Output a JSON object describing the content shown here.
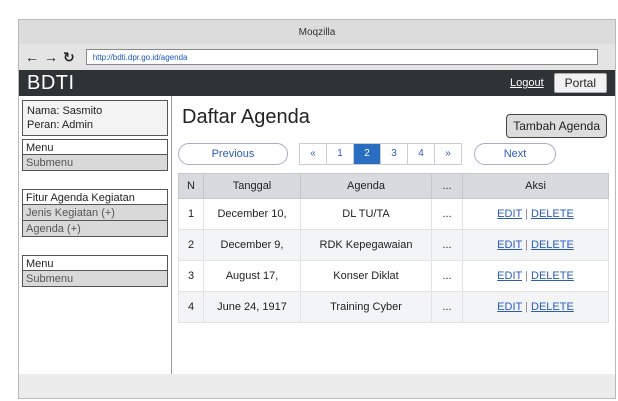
{
  "browser": {
    "title": "Moqzilla",
    "url": "http://bdti.dpr.go.id/agenda",
    "nav": [
      "←",
      "→",
      "↻"
    ]
  },
  "app": {
    "brand": "BDTI",
    "logout": "Logout",
    "portal": "Portal"
  },
  "user": {
    "nama": "Nama: Sasmito",
    "peran": "Peran: Admin"
  },
  "sidebar": {
    "menu1": "Menu",
    "submenu1": "Submenu",
    "fitur": "Fitur Agenda Kegiatan",
    "jenis": "Jenis Kegiatan (+)",
    "agenda": "Agenda (+)",
    "menu2": "Menu",
    "submenu2": "Submenu"
  },
  "main": {
    "title": "Daftar Agenda",
    "add_button": "Tambah Agenda"
  },
  "pager": {
    "previous": "Previous",
    "next": "Next",
    "first": "«",
    "last": "»",
    "pages": [
      "1",
      "2",
      "3",
      "4"
    ],
    "active": "2"
  },
  "table": {
    "headers": [
      "N",
      "Tanggal",
      "Agenda",
      "...",
      "Aksi"
    ],
    "rows": [
      {
        "n": "1",
        "tanggal": "December 10,",
        "agenda": "DL TU/TA",
        "more": "...",
        "edit": "EDIT",
        "delete": "DELETE"
      },
      {
        "n": "2",
        "tanggal": "December 9,",
        "agenda": "RDK Kepegawaian",
        "more": "...",
        "edit": "EDIT",
        "delete": "DELETE"
      },
      {
        "n": "3",
        "tanggal": "August 17,",
        "agenda": "Konser Diklat",
        "more": "...",
        "edit": "EDIT",
        "delete": "DELETE"
      },
      {
        "n": "4",
        "tanggal": "June 24, 1917",
        "agenda": "Training Cyber",
        "more": "...",
        "edit": "EDIT",
        "delete": "DELETE"
      }
    ]
  }
}
